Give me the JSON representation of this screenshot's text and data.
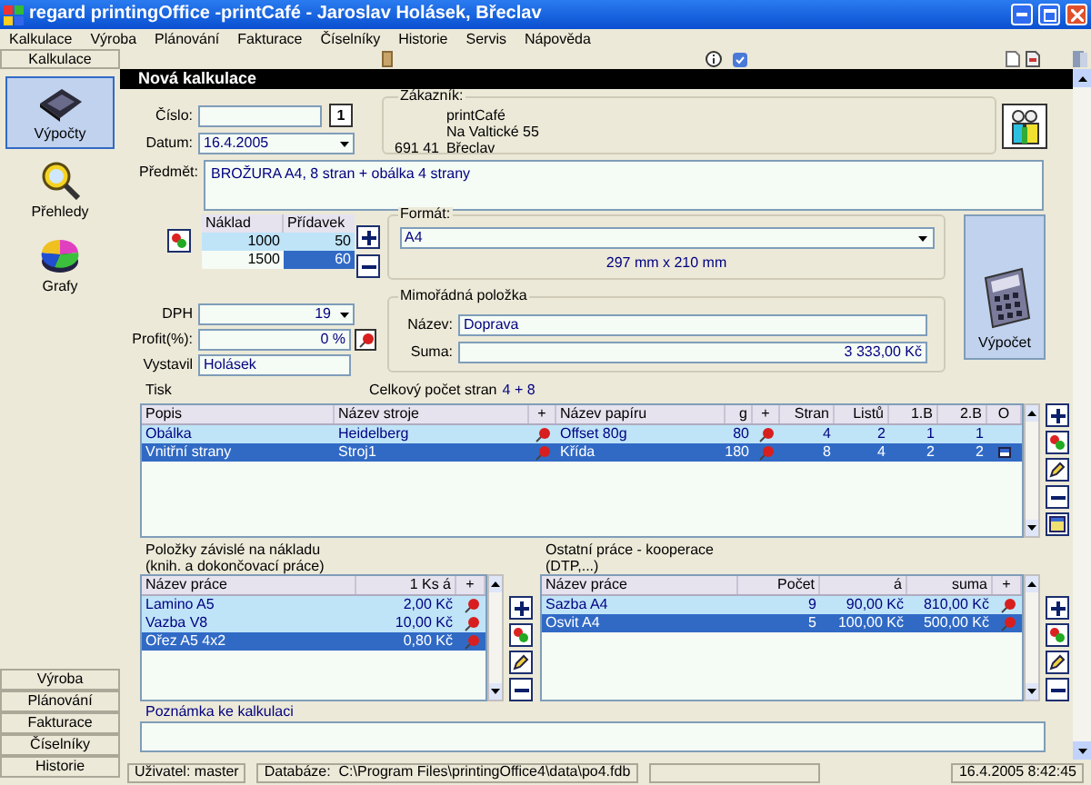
{
  "window": {
    "title": "regard printingOffice -printCafé - Jaroslav Holásek, Břeclav"
  },
  "menu": [
    "Kalkulace",
    "Výroba",
    "Plánování",
    "Fakturace",
    "Číselníky",
    "Historie",
    "Servis",
    "Nápověda"
  ],
  "sidebar": {
    "header": "Kalkulace",
    "items": [
      {
        "label": "Výpočty",
        "selected": true
      },
      {
        "label": "Přehledy",
        "selected": false
      },
      {
        "label": "Grafy",
        "selected": false
      }
    ],
    "modules": [
      "Výroba",
      "Plánování",
      "Fakturace",
      "Číselníky",
      "Historie"
    ]
  },
  "form": {
    "title": "Nová kalkulace",
    "cislo": {
      "label": "Číslo:",
      "button": "1"
    },
    "datum": {
      "label": "Datum:",
      "value": "16.4.2005"
    },
    "zakaznik": {
      "label": "Zákazník:",
      "name": "printCafé",
      "street": "Na Valtické 55",
      "zip": "691 41",
      "city": "Břeclav"
    },
    "predmet": {
      "label": "Předmět:",
      "value": "BROŽURA A4, 8 stran + obálka 4 strany"
    },
    "quantities": {
      "columns": [
        "Náklad",
        "Přídavek"
      ],
      "rows": [
        {
          "naklad": "1000",
          "pridavek": "50",
          "selected": false
        },
        {
          "naklad": "1500",
          "pridavek": "60",
          "selected": true
        }
      ]
    },
    "format": {
      "label": "Formát:",
      "value": "A4",
      "size": "297 mm x 210 mm"
    },
    "dph": {
      "label": "DPH",
      "value": "19"
    },
    "profit": {
      "label": "Profit(%):",
      "value": "0 %"
    },
    "vystavil": {
      "label": "Vystavil",
      "value": "Holásek"
    },
    "extra": {
      "label": "Mimořádná položka",
      "name_label": "Název:",
      "name": "Doprava",
      "sum_label": "Suma:",
      "sum": "3 333,00 Kč"
    },
    "calc_button": "Výpočet"
  },
  "print": {
    "label": "Tisk",
    "total_label": "Celkový počet stran",
    "total": "4 + 8",
    "columns": [
      {
        "label": "Popis",
        "kind": "text"
      },
      {
        "label": "Název stroje",
        "kind": "text"
      },
      {
        "label": "+",
        "kind": "pin"
      },
      {
        "label": "Název papíru",
        "kind": "text"
      },
      {
        "label": "g",
        "kind": "text"
      },
      {
        "label": "+",
        "kind": "pin"
      },
      {
        "label": "Stran",
        "kind": "text"
      },
      {
        "label": "Listů",
        "kind": "text"
      },
      {
        "label": "1.B",
        "kind": "text"
      },
      {
        "label": "2.B",
        "kind": "text"
      },
      {
        "label": "O",
        "kind": "flag"
      }
    ],
    "rows": [
      {
        "cells": [
          "Obálka",
          "Heidelberg",
          "",
          "Offset 80g",
          "80",
          "",
          "4",
          "2",
          "1",
          "1",
          ""
        ],
        "flag": false,
        "selected": false
      },
      {
        "cells": [
          "Vnitřní strany",
          "Stroj1",
          "",
          "Křída",
          "180",
          "",
          "8",
          "4",
          "2",
          "2",
          ""
        ],
        "flag": true,
        "selected": true
      }
    ]
  },
  "works": {
    "label_lines": [
      "Položky závislé na nákladu",
      "(knih. a dokončovací práce)"
    ],
    "columns": [
      {
        "label": "Název práce",
        "kind": "text"
      },
      {
        "label": "1 Ks á",
        "kind": "text"
      },
      {
        "label": "+",
        "kind": "pin"
      }
    ],
    "rows": [
      {
        "cells": [
          "Lamino A5",
          "2,00 Kč"
        ],
        "selected": false
      },
      {
        "cells": [
          "Vazba V8",
          "10,00 Kč"
        ],
        "selected": false
      },
      {
        "cells": [
          "Ořez A5 4x2",
          "0,80 Kč"
        ],
        "selected": true
      }
    ]
  },
  "coop": {
    "label_lines": [
      "Ostatní práce - kooperace",
      "(DTP,...)"
    ],
    "columns": [
      {
        "label": "Název práce",
        "kind": "text"
      },
      {
        "label": "Počet",
        "kind": "text"
      },
      {
        "label": "á",
        "kind": "text"
      },
      {
        "label": "suma",
        "kind": "text"
      },
      {
        "label": "+",
        "kind": "pin"
      }
    ],
    "rows": [
      {
        "cells": [
          "Sazba A4",
          "9",
          "90,00 Kč",
          "810,00 Kč"
        ],
        "selected": false
      },
      {
        "cells": [
          "Osvit A4",
          "5",
          "100,00 Kč",
          "500,00 Kč"
        ],
        "selected": true
      }
    ]
  },
  "note": {
    "label": "Poznámka ke kalkulaci"
  },
  "status_bar": {
    "user": "Uživatel: master",
    "database": "Databáze:  C:\\Program Files\\printingOffice4\\data\\po4.fdb",
    "datetime": "16.4.2005 8:42:45"
  }
}
